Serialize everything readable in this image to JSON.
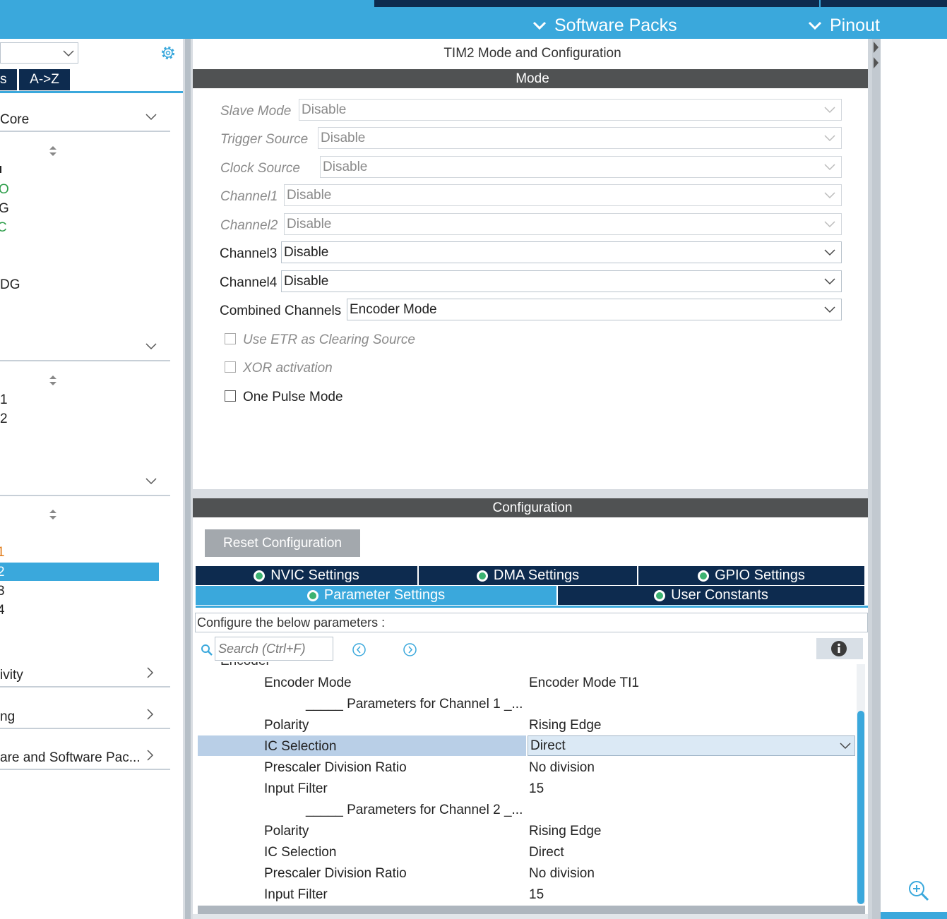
{
  "topbar": {
    "software_packs": "Software Packs",
    "pinout": "Pinout"
  },
  "left": {
    "tabs": [
      "s",
      "A->Z"
    ],
    "sections": [
      {
        "label": "Core",
        "chevron": "down"
      },
      {
        "label": "ivity",
        "chevron": "right"
      },
      {
        "label": "ng",
        "chevron": "right"
      },
      {
        "label": "are and Software Pac...",
        "chevron": "right"
      }
    ],
    "core_items": [
      "1",
      "O",
      "G",
      "C",
      "DG"
    ],
    "group2_items": [
      "1",
      "2"
    ],
    "group3_items": [
      "1",
      "2",
      "3",
      "4"
    ]
  },
  "mode_panel": {
    "title": "TIM2 Mode and Configuration",
    "header": "Mode",
    "fields": [
      {
        "label": "Slave Mode",
        "value": "Disable",
        "enabled": false
      },
      {
        "label": "Trigger Source",
        "value": "Disable",
        "enabled": false
      },
      {
        "label": "Clock Source",
        "value": "Disable",
        "enabled": false
      },
      {
        "label": "Channel1",
        "value": "Disable",
        "enabled": false
      },
      {
        "label": "Channel2",
        "value": "Disable",
        "enabled": false
      },
      {
        "label": "Channel3",
        "value": "Disable",
        "enabled": true
      },
      {
        "label": "Channel4",
        "value": "Disable",
        "enabled": true
      },
      {
        "label": "Combined Channels",
        "value": "Encoder Mode",
        "enabled": true
      }
    ],
    "checkboxes": [
      {
        "label": "Use ETR as Clearing Source",
        "enabled": false,
        "checked": false
      },
      {
        "label": "XOR activation",
        "enabled": false,
        "checked": false
      },
      {
        "label": "One Pulse Mode",
        "enabled": true,
        "checked": false
      }
    ]
  },
  "config_panel": {
    "header": "Configuration",
    "reset_button": "Reset Configuration",
    "tabs_row1": [
      "NVIC Settings",
      "DMA Settings",
      "GPIO Settings"
    ],
    "tabs_row2": [
      "Parameter Settings",
      "User Constants"
    ],
    "active_tab": "Parameter Settings",
    "hint": "Configure the below parameters :",
    "search_placeholder": "Search (Ctrl+F)",
    "partial_group": "Encoder",
    "params": [
      {
        "name": "Encoder Mode",
        "value": "Encoder Mode TI1"
      },
      {
        "name": "_____ Parameters for Channel 1 _...",
        "value": ""
      },
      {
        "name": "Polarity",
        "value": "Rising Edge"
      },
      {
        "name": "IC Selection",
        "value": "Direct",
        "selected": true
      },
      {
        "name": "Prescaler Division Ratio",
        "value": "No division"
      },
      {
        "name": "Input Filter",
        "value": "15"
      },
      {
        "name": "_____ Parameters for Channel 2 _...",
        "value": ""
      },
      {
        "name": "Polarity",
        "value": "Rising Edge"
      },
      {
        "name": "IC Selection",
        "value": "Direct"
      },
      {
        "name": "Prescaler Division Ratio",
        "value": "No division"
      },
      {
        "name": "Input Filter",
        "value": "15"
      }
    ]
  },
  "colors": {
    "accent_blue": "#3aa8dc",
    "navy": "#0d2b4f",
    "header_gray": "#505253",
    "selection": "#b9cfe7"
  }
}
